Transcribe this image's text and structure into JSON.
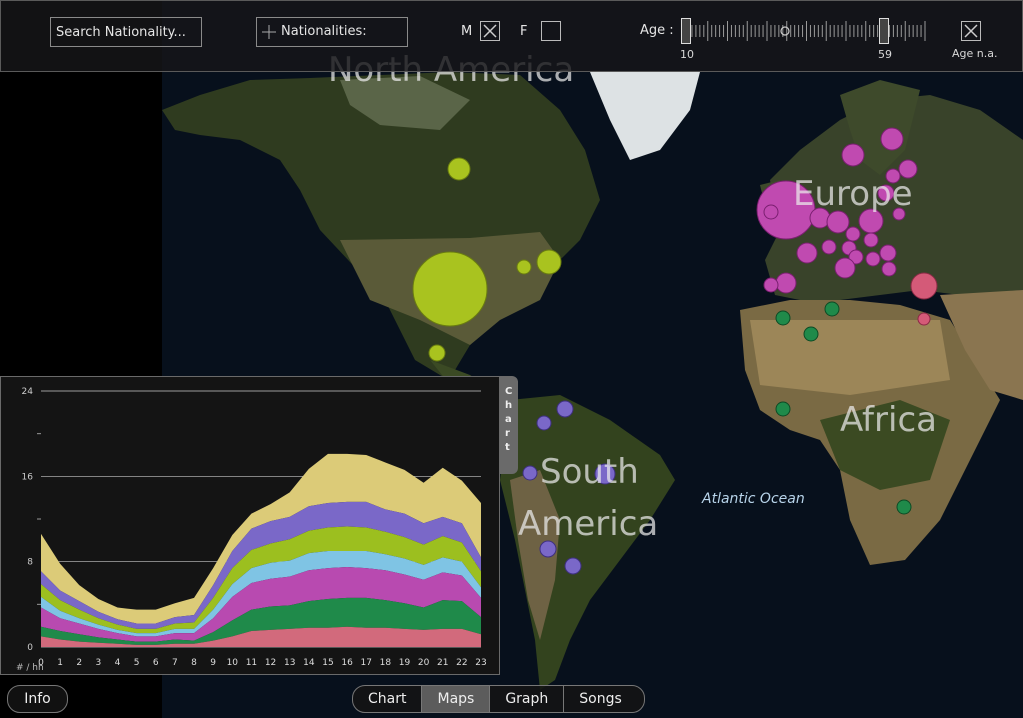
{
  "toolbar": {
    "search_placeholder": "Search Nationality...",
    "nationalities_label": "Nationalities:",
    "male_label": "M",
    "female_label": "F",
    "male_checked": true,
    "female_checked": false,
    "age_label": "Age :",
    "age_min": "10",
    "age_max": "59",
    "age_na_label": "Age n.a."
  },
  "map": {
    "labels": {
      "north_america": "North America",
      "europe": "Europe",
      "africa": "Africa",
      "south_america_1": "South",
      "south_america_2": "America",
      "atlantic": "Atlantic Ocean"
    },
    "colors": {
      "north_america": "#a9c31f",
      "europe": "#c04ab0",
      "africa": "#1f8a4a",
      "south_america": "#7a68c8",
      "middle_east": "#d45a78"
    }
  },
  "chart_panel": {
    "tab_label": "Chart",
    "unit_label": "# / hh"
  },
  "chart_data": {
    "type": "area",
    "x": [
      0,
      1,
      2,
      3,
      4,
      5,
      6,
      7,
      8,
      9,
      10,
      11,
      12,
      13,
      14,
      15,
      16,
      17,
      18,
      19,
      20,
      21,
      22,
      23
    ],
    "ylim": [
      0,
      24
    ],
    "yticks": [
      0,
      8,
      16,
      24
    ],
    "xlabel": "",
    "ylabel": "",
    "series": [
      {
        "color": "#d26a7c",
        "values": [
          1.0,
          0.7,
          0.5,
          0.4,
          0.3,
          0.2,
          0.2,
          0.3,
          0.3,
          0.6,
          1.0,
          1.5,
          1.6,
          1.7,
          1.8,
          1.8,
          1.9,
          1.8,
          1.8,
          1.7,
          1.6,
          1.7,
          1.7,
          1.2
        ]
      },
      {
        "color": "#1f8a4a",
        "values": [
          0.9,
          0.8,
          0.7,
          0.5,
          0.4,
          0.3,
          0.3,
          0.4,
          0.3,
          0.8,
          1.5,
          2.0,
          2.2,
          2.2,
          2.5,
          2.7,
          2.7,
          2.8,
          2.6,
          2.4,
          2.1,
          2.7,
          2.6,
          1.6
        ]
      },
      {
        "color": "#b84ab0",
        "values": [
          1.8,
          1.2,
          1.0,
          0.8,
          0.6,
          0.5,
          0.5,
          0.6,
          0.7,
          1.3,
          2.2,
          2.5,
          2.6,
          2.7,
          2.9,
          2.9,
          2.9,
          2.8,
          2.8,
          2.7,
          2.6,
          2.6,
          2.4,
          1.8
        ]
      },
      {
        "color": "#7fc4e4",
        "values": [
          1.0,
          0.7,
          0.5,
          0.4,
          0.3,
          0.3,
          0.3,
          0.4,
          0.4,
          0.8,
          1.2,
          1.4,
          1.5,
          1.5,
          1.6,
          1.6,
          1.5,
          1.6,
          1.5,
          1.5,
          1.4,
          1.4,
          1.3,
          1.0
        ]
      },
      {
        "color": "#9cbf1f",
        "values": [
          1.2,
          1.0,
          0.8,
          0.6,
          0.5,
          0.4,
          0.4,
          0.5,
          0.6,
          1.1,
          1.5,
          1.7,
          1.8,
          2.0,
          2.1,
          2.2,
          2.3,
          2.2,
          2.1,
          2.0,
          1.9,
          2.0,
          1.8,
          1.5
        ]
      },
      {
        "color": "#7a68c8",
        "values": [
          1.2,
          0.9,
          0.8,
          0.6,
          0.5,
          0.5,
          0.5,
          0.6,
          0.7,
          1.2,
          1.6,
          2.0,
          2.1,
          2.1,
          2.3,
          2.3,
          2.3,
          2.4,
          2.1,
          2.2,
          2.0,
          1.8,
          1.8,
          1.3
        ]
      },
      {
        "color": "#dccb78",
        "values": [
          3.5,
          2.5,
          1.5,
          1.2,
          1.1,
          1.3,
          1.3,
          1.3,
          1.6,
          1.6,
          1.5,
          1.4,
          1.6,
          2.3,
          3.5,
          4.6,
          4.5,
          4.4,
          4.4,
          4.1,
          3.8,
          4.6,
          4.0,
          5.1
        ]
      }
    ]
  },
  "nav": {
    "info_label": "Info",
    "tabs": [
      "Chart",
      "Maps",
      "Graph",
      "Songs"
    ],
    "active_tab": "Maps"
  }
}
